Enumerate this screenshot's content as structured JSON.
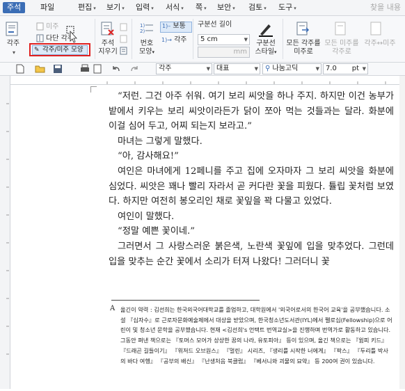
{
  "menubar": {
    "active_tab": "주석",
    "items": [
      {
        "label": "파일",
        "arrow": ""
      },
      {
        "label": "편집",
        "arrow": "▾"
      },
      {
        "label": "보기",
        "arrow": "▾"
      },
      {
        "label": "입력",
        "arrow": "▾"
      },
      {
        "label": "서식",
        "arrow": "▾"
      },
      {
        "label": "쪽",
        "arrow": "▾"
      },
      {
        "label": "보안",
        "arrow": "▾"
      },
      {
        "label": "검토",
        "arrow": "▾"
      },
      {
        "label": "도구",
        "arrow": "▾"
      }
    ],
    "right_text": "찾을 내용"
  },
  "ribbon": {
    "footnote_btn": "각주",
    "endnote_btn": "미주",
    "multi_footnote_btn": "다단 각주",
    "fn_en_shape_btn": "각주/미주 모양",
    "delete_btn_line1": "주석",
    "delete_btn_line2": "지우기",
    "number_btn_line1": "번호",
    "number_btn_line2": "모양",
    "normal_btn": "보통",
    "fn_btn": "각주",
    "separator_len_label": "구분선 길이",
    "separator_len_value": "5 cm",
    "mm_label": "mm",
    "separator_style_line1": "구분선",
    "separator_style_line2": "스타일",
    "all_to_endnote_line1": "모든 각주를",
    "all_to_endnote_line2": "미주로",
    "all_to_footnote_line1": "모든 미주를",
    "all_to_footnote_line2": "각주로",
    "swap_btn": "각주↔미주"
  },
  "toolbar2": {
    "style_value": "각주",
    "lang_value": "대표",
    "font_value": "나눔고딕",
    "size_value": "7.0",
    "unit_value": "pt"
  },
  "document": {
    "paragraphs": [
      "“저런. 그건 아주 쉬워. 여기 보리 씨앗을 하나 주지. 하지만 이건 농부가 밭에서 키우는 보리 씨앗이라든가 닭이 쪼아 먹는 것들과는 달라. 화분에 이걸 심어 두고, 어찌 되는지 보라고.”",
      "마녀는 그렇게 말했다.",
      "“아, 감사해요!”",
      "여인은 마녀에게 12페니를 주고 집에 오자마자 그 보리 씨앗을 화분에 심었다. 씨앗은 꽤나 빨리 자라서 곧 커다란 꽃을 피웠다. 튤립 꽃처럼 보였다. 하지만 여전히 봉오리인 채로 꽃잎을 꽉 다물고 있었다.",
      "여인이 말했다.",
      "“정말 예쁜 꽃이네.”",
      "그러면서 그 사랑스러운 붉은색, 노란색 꽃잎에 입을 맞추었다. 그런데 입을 맞추는 순간 꽃에서 소리가 터져 나왔다! 그러더니 꽃"
    ],
    "footnote_marker": "A",
    "footnote_text": "옮긴이 약력 : 김선희는 한국외국어대학교를 졸업하고, 대학원에서 '외국어로서의 한국어 교육'을 공부했습니다. 소설 『십자수』로 근로자문화예술제에서 대상을 받았으며, 한국청소년도서관(IYL)에서 펠로십(Fellowship)으로 어린이 및 청소년 문학을 공부했습니다. 현재 <김선희's 언택트 번역교실>을 진행하며 번역가로 활동하고 있습니다. 그동안 펴낸 책으로는 『토머스 모어가 상상한 꿈의 나라, 유토피아』 등이 있으며, 옮긴 책으로는 『윔피 키드』 『드래곤 길들이기』 『위저드 오브원스』 『멀린』 시리즈, 『생리를 시작한 너에게』 『팍스』 『두리틀 박사의 바다 여행』 『공부의 배신』 『난생처음 북클럽』 『베서니와 괴물의 묘약』 등 200여 권이 있습니다."
  },
  "colors": {
    "accent": "#3b6db5",
    "highlight_box": "#e02020"
  }
}
